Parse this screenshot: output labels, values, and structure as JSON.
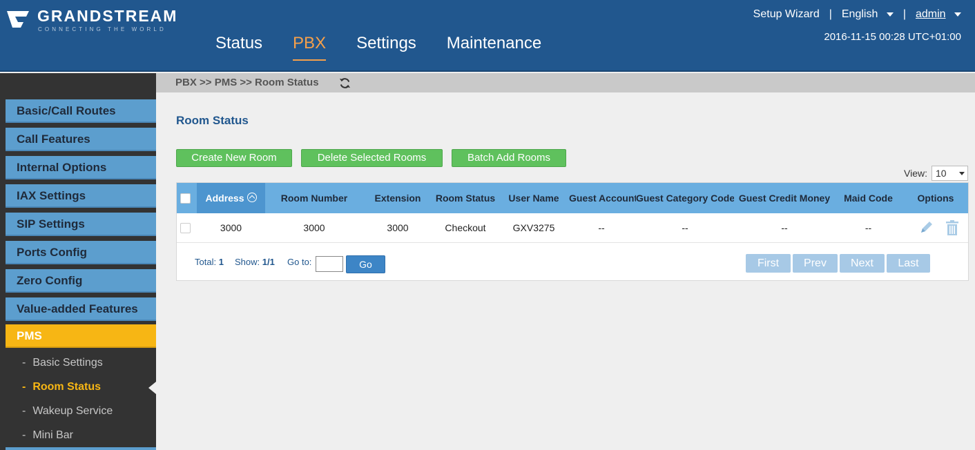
{
  "brand": {
    "name": "GRANDSTREAM",
    "tagline": "CONNECTING THE WORLD"
  },
  "nav": {
    "items": [
      "Status",
      "PBX",
      "Settings",
      "Maintenance"
    ],
    "active": "PBX"
  },
  "top_right": {
    "setup_wizard": "Setup Wizard",
    "sep": "|",
    "language": "English",
    "user": "admin"
  },
  "datetime": "2016-11-15 00:28 UTC+01:00",
  "sidebar": {
    "items": [
      "Basic/Call Routes",
      "Call Features",
      "Internal Options",
      "IAX Settings",
      "SIP Settings",
      "Ports Config",
      "Zero Config",
      "Value-added Features",
      "PMS"
    ],
    "sub_items": [
      "Basic Settings",
      "Room Status",
      "Wakeup Service",
      "Mini Bar"
    ],
    "dash": "-"
  },
  "breadcrumb": "PBX >> PMS >> Room Status",
  "page_title": "Room Status",
  "buttons": {
    "create": "Create New Room",
    "delete": "Delete Selected Rooms",
    "batch": "Batch Add Rooms"
  },
  "view": {
    "label": "View:",
    "value": "10"
  },
  "table": {
    "headers": [
      "Address",
      "Room Number",
      "Extension",
      "Room Status",
      "User Name",
      "Guest Account",
      "Guest Category Code",
      "Guest Credit Money",
      "Maid Code",
      "Options"
    ],
    "rows": [
      [
        "3000",
        "3000",
        "3000",
        "Checkout",
        "GXV3275",
        "--",
        "--",
        "--",
        "--"
      ]
    ]
  },
  "footer": {
    "total_label": "Total:",
    "total": "1",
    "show_label": "Show:",
    "show": "1/1",
    "goto_label": "Go to:",
    "go": "Go"
  },
  "pager": [
    "First",
    "Prev",
    "Next",
    "Last"
  ],
  "colors": {
    "header": "#21578e",
    "accent": "#f6a04a",
    "sidebar_item": "#5c9ece",
    "sidebar_active": "#f7b614",
    "button_green": "#5fc15d",
    "table_header": "#6aaee0"
  }
}
